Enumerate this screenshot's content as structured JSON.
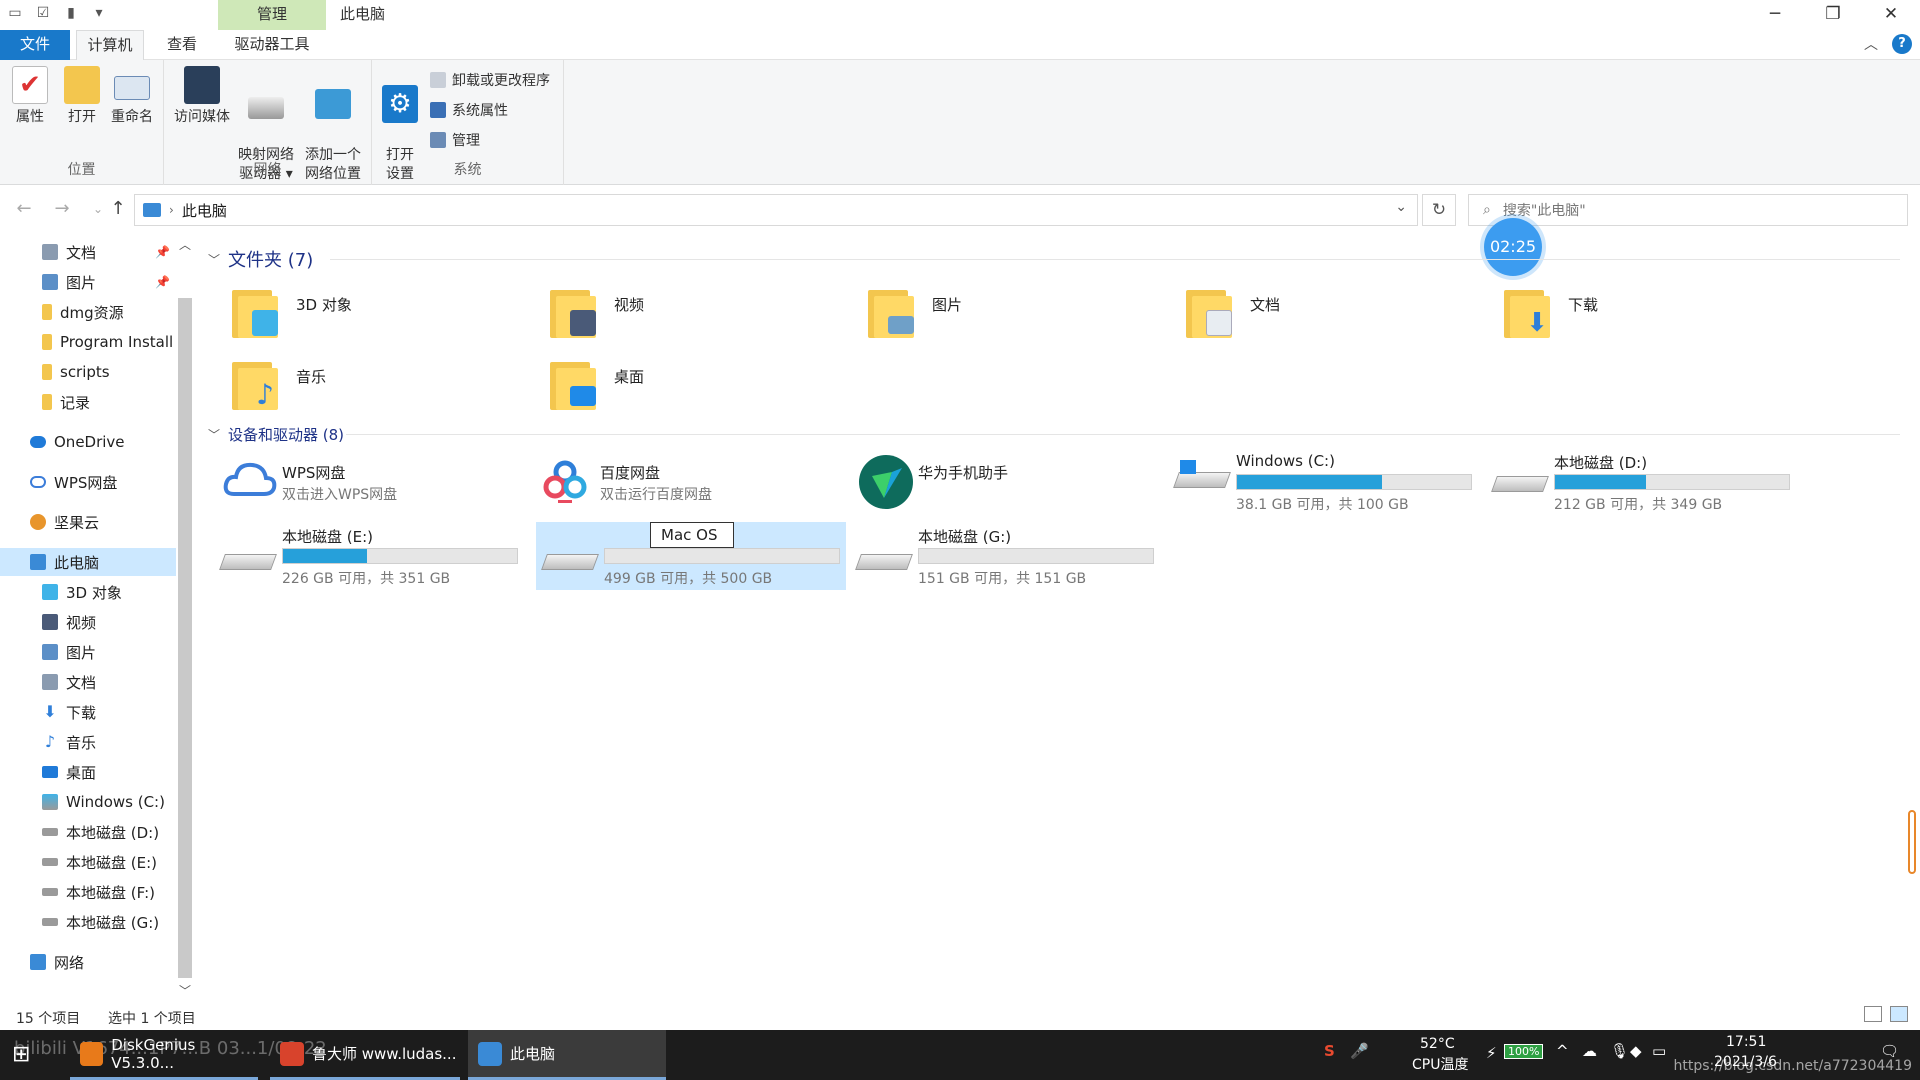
{
  "window": {
    "title": "此电脑",
    "context_tab": "管理",
    "controls": [
      "─",
      "❐",
      "✕"
    ]
  },
  "tabs": [
    {
      "label": "文件"
    },
    {
      "label": "计算机"
    },
    {
      "label": "查看"
    },
    {
      "label": "驱动器工具"
    }
  ],
  "ribbon": {
    "groups": [
      {
        "label": "位置",
        "buttons": [
          "属性",
          "打开",
          "重命名"
        ]
      },
      {
        "label": "网络",
        "buttons": [
          "访问媒体",
          "映射网络\n驱动器 ▾",
          "添加一个\n网络位置"
        ]
      },
      {
        "label": "系统",
        "buttons": [
          "打开\n设置"
        ],
        "small": [
          "卸载或更改程序",
          "系统属性",
          "管理"
        ]
      }
    ]
  },
  "address": {
    "path": "此电脑",
    "search_placeholder": "搜索\"此电脑\""
  },
  "timer": "02:25",
  "sidebar": {
    "items": [
      {
        "label": "文档",
        "pinned": true,
        "color": "#8a9bb0"
      },
      {
        "label": "图片",
        "pinned": true,
        "color": "#5b8fc7"
      },
      {
        "label": "dmg资源",
        "color": "#f3c64e"
      },
      {
        "label": "Program Install",
        "color": "#f3c64e"
      },
      {
        "label": "scripts",
        "color": "#f3c64e"
      },
      {
        "label": "记录",
        "color": "#f3c64e"
      },
      {
        "label": "OneDrive",
        "color": "#1f7ad8"
      },
      {
        "label": "WPS网盘",
        "color": "#3c7dd9"
      },
      {
        "label": "坚果云",
        "color": "#e8952c"
      },
      {
        "label": "此电脑",
        "color": "#3a8ad6",
        "selected": true
      },
      {
        "label": "3D 对象",
        "color": "#3fb3e8"
      },
      {
        "label": "视频",
        "color": "#4a5a78"
      },
      {
        "label": "图片",
        "color": "#5b8fc7"
      },
      {
        "label": "文档",
        "color": "#8a9bb0"
      },
      {
        "label": "下载",
        "color": "#2f7fd9"
      },
      {
        "label": "音乐",
        "color": "#2f7fd9"
      },
      {
        "label": "桌面",
        "color": "#1f7ad8"
      },
      {
        "label": "Windows (C:)",
        "color": "#3fb3e8"
      },
      {
        "label": "本地磁盘 (D:)",
        "color": "#9a9a9a"
      },
      {
        "label": "本地磁盘 (E:)",
        "color": "#9a9a9a"
      },
      {
        "label": "本地磁盘 (F:)",
        "color": "#9a9a9a"
      },
      {
        "label": "本地磁盘 (G:)",
        "color": "#9a9a9a"
      },
      {
        "label": "网络",
        "color": "#3a8ad6"
      }
    ]
  },
  "folders_section": {
    "title": "文件夹 (7)",
    "items": [
      {
        "label": "3D 对象",
        "badge": "#3fb3e8"
      },
      {
        "label": "视频",
        "badge": "#4a5a78"
      },
      {
        "label": "图片",
        "badge": "#6fa0c8"
      },
      {
        "label": "文档",
        "badge": "#e8edf2"
      },
      {
        "label": "下载",
        "badge": "#2f7fd9"
      },
      {
        "label": "音乐",
        "badge": "#2f7fd9"
      },
      {
        "label": "桌面",
        "badge": "#1f8ae8"
      }
    ]
  },
  "devices_section": {
    "title": "设备和驱动器 (8)",
    "apps": [
      {
        "label": "WPS网盘",
        "sub": "双击进入WPS网盘"
      },
      {
        "label": "百度网盘",
        "sub": "双击运行百度网盘"
      },
      {
        "label": "华为手机助手",
        "sub": ""
      }
    ],
    "drives": [
      {
        "label": "Windows (C:)",
        "free": "38.1 GB 可用，共 100 GB",
        "used_fraction": 0.62
      },
      {
        "label": "本地磁盘 (D:)",
        "free": "212 GB 可用，共 349 GB",
        "used_fraction": 0.39
      },
      {
        "label": "本地磁盘 (E:)",
        "free": "226 GB 可用，共 351 GB",
        "used_fraction": 0.36
      },
      {
        "label": "Mac OS",
        "free": "499 GB 可用，共 500 GB",
        "used_fraction": 0.0,
        "selected": true,
        "renaming": true
      },
      {
        "label": "本地磁盘 (G:)",
        "free": "151 GB 可用，共 151 GB",
        "used_fraction": 0.0
      }
    ]
  },
  "status": {
    "count": "15 个项目",
    "selected": "选中 1 个项目"
  },
  "taskbar": {
    "watermark": "bilibili  V1674...1P7...B  03...1/08-22",
    "apps": [
      {
        "label": "DiskGenius V5.3.0...",
        "color": "#e87a1a"
      },
      {
        "label": "鲁大师 www.ludas...",
        "color": "#d8432c"
      },
      {
        "label": "此电脑",
        "color": "#3a8ad6",
        "active": true
      }
    ],
    "temp": "52°C",
    "temp_label": "CPU温度",
    "battery": "100%",
    "time": "17:51",
    "date": "2021/3/6",
    "url_watermark": "https://blog.csdn.net/a772304419"
  }
}
